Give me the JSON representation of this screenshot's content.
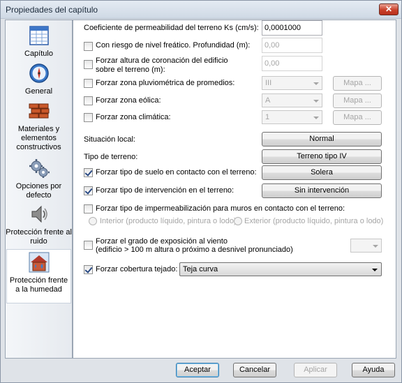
{
  "window": {
    "title": "Propiedades del capítulo",
    "close_label": "✕"
  },
  "sidebar": {
    "items": [
      {
        "label": "Capítulo",
        "icon": "table-icon"
      },
      {
        "label": "General",
        "icon": "compass-icon"
      },
      {
        "label": "Materiales y elementos constructivos",
        "icon": "bricks-icon"
      },
      {
        "label": "Opciones por defecto",
        "icon": "gears-icon"
      },
      {
        "label": "Protección frente al ruido",
        "icon": "speaker-icon"
      },
      {
        "label": "Protección frente a la humedad",
        "icon": "humidity-icon"
      }
    ],
    "selected_index": 5
  },
  "form": {
    "permeability": {
      "label": "Coeficiente de permeabilidad del terreno Ks (cm/s):",
      "value": "0,0001000"
    },
    "phreatic": {
      "label": "Con riesgo de nivel freático. Profundidad (m):",
      "value": "0,00",
      "checked": false
    },
    "crown_height": {
      "label_1": "Forzar altura de coronación del edificio",
      "label_2": "sobre el terreno (m):",
      "value": "0,00",
      "checked": false
    },
    "rain_zone": {
      "label": "Forzar zona pluviométrica de promedios:",
      "value": "III",
      "button": "Mapa ...",
      "checked": false
    },
    "wind_zone": {
      "label": "Forzar zona eólica:",
      "value": "A",
      "button": "Mapa ...",
      "checked": false
    },
    "climate_zone": {
      "label": "Forzar zona climática:",
      "value": "1",
      "button": "Mapa ...",
      "checked": false
    },
    "local_situation": {
      "label": "Situación local:",
      "button": "Normal"
    },
    "terrain_type": {
      "label": "Tipo de terreno:",
      "button": "Terreno tipo IV"
    },
    "soil_type": {
      "label": "Forzar tipo de suelo en contacto con el terreno:",
      "button": "Solera",
      "checked": true
    },
    "intervention_type": {
      "label": "Forzar tipo de intervención en el terreno:",
      "button": "Sin intervención",
      "checked": true
    },
    "waterproofing": {
      "label": "Forzar tipo de impermeabilización para muros en contacto con el terreno:",
      "checked": false,
      "option_interior": "Interior (producto líquido, pintura o lodo)",
      "option_exterior": "Exterior (producto líquido, pintura o lodo)"
    },
    "wind_exposure": {
      "label_1": "Forzar el grado de exposición al viento",
      "label_2": "(edificio > 100 m altura o próximo a desnivel pronunciado)",
      "value": "",
      "checked": false
    },
    "roof_cover": {
      "label": "Forzar cobertura tejado:",
      "value": "Teja curva",
      "checked": true
    }
  },
  "footer": {
    "accept": "Aceptar",
    "cancel": "Cancelar",
    "apply": "Aplicar",
    "help": "Ayuda"
  }
}
